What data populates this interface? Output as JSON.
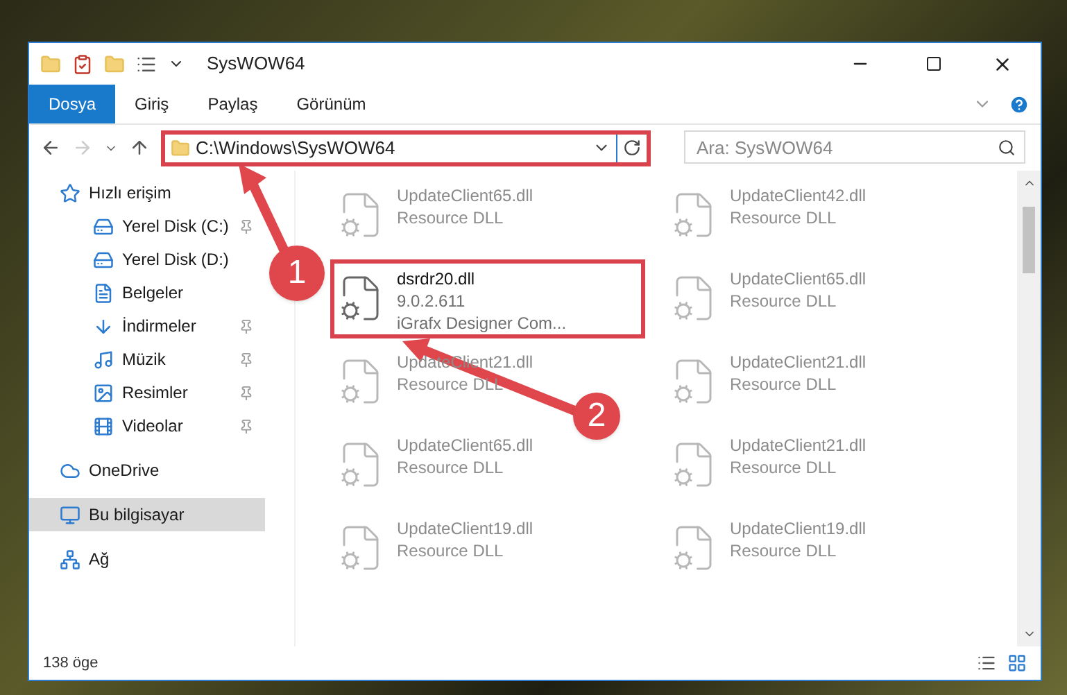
{
  "window": {
    "title": "SysWOW64"
  },
  "ribbon_tabs": [
    {
      "label": "Dosya",
      "selected": true
    },
    {
      "label": "Giriş",
      "selected": false
    },
    {
      "label": "Paylaş",
      "selected": false
    },
    {
      "label": "Görünüm",
      "selected": false
    }
  ],
  "address": {
    "value": "C:\\Windows\\SysWOW64",
    "highlighted": true
  },
  "search": {
    "placeholder": "Ara: SysWOW64"
  },
  "sidebar": {
    "items": [
      {
        "label": "Hızlı erişim",
        "selected": false,
        "children": [
          {
            "label": "Yerel Disk (C:)",
            "pinned": true,
            "selected": false
          },
          {
            "label": "Yerel Disk (D:)",
            "selected": false
          },
          {
            "label": "Belgeler",
            "selected": false
          },
          {
            "label": "İndirmeler",
            "pinned": true,
            "selected": false
          },
          {
            "label": "Müzik",
            "pinned": true,
            "selected": false
          },
          {
            "label": "Resimler",
            "pinned": true,
            "selected": false
          },
          {
            "label": "Videolar",
            "pinned": true,
            "selected": false
          }
        ]
      },
      {
        "label": "OneDrive",
        "selected": false
      },
      {
        "label": "Bu bilgisayar",
        "selected": true
      },
      {
        "label": "Ağ",
        "selected": false
      }
    ]
  },
  "files": [
    {
      "name": "UpdateClient65.dll",
      "lines": [
        "Resource DLL"
      ],
      "highlighted": false
    },
    {
      "name": "UpdateClient42.dll",
      "lines": [
        "Resource DLL"
      ],
      "highlighted": false
    },
    {
      "name": "dsrdr20.dll",
      "lines": [
        "9.0.2.611",
        "iGrafx Designer Com..."
      ],
      "highlighted": true
    },
    {
      "name": "UpdateClient65.dll",
      "lines": [
        "Resource DLL"
      ],
      "highlighted": false
    },
    {
      "name": "UpdateClient21.dll",
      "lines": [
        "Resource DLL"
      ],
      "highlighted": false
    },
    {
      "name": "UpdateClient21.dll",
      "lines": [
        "Resource DLL"
      ],
      "highlighted": false
    },
    {
      "name": "UpdateClient65.dll",
      "lines": [
        "Resource DLL"
      ],
      "highlighted": false
    },
    {
      "name": "UpdateClient21.dll",
      "lines": [
        "Resource DLL"
      ],
      "highlighted": false
    },
    {
      "name": "UpdateClient19.dll",
      "lines": [
        "Resource DLL"
      ],
      "highlighted": false
    },
    {
      "name": "UpdateClient19.dll",
      "lines": [
        "Resource DLL"
      ],
      "highlighted": false
    }
  ],
  "status_bar": {
    "count": "138 öge"
  },
  "annotations": [
    {
      "label": "1"
    },
    {
      "label": "2"
    }
  ]
}
